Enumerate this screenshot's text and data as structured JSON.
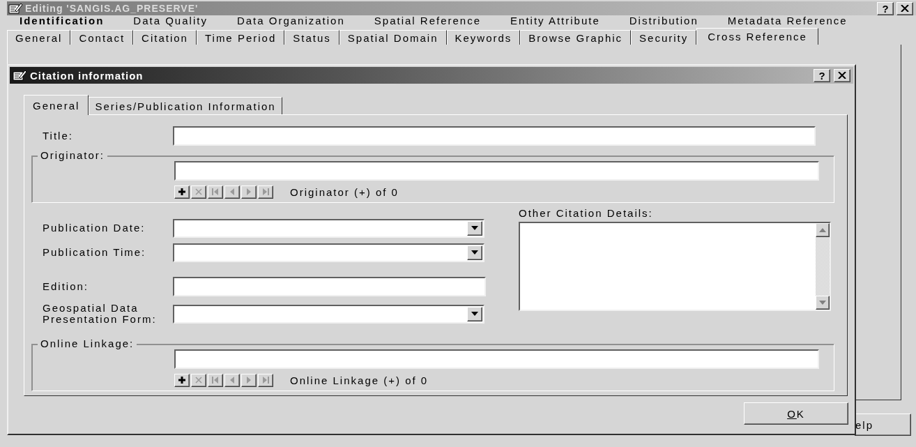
{
  "window": {
    "title": "Editing 'SANGIS.AG_PRESERVE'",
    "help": "?"
  },
  "sections": [
    {
      "label": "Identification",
      "selected": true
    },
    {
      "label": "Data Quality",
      "selected": false
    },
    {
      "label": "Data Organization",
      "selected": false
    },
    {
      "label": "Spatial Reference",
      "selected": false
    },
    {
      "label": "Entity Attribute",
      "selected": false
    },
    {
      "label": "Distribution",
      "selected": false
    },
    {
      "label": "Metadata Reference",
      "selected": false
    }
  ],
  "tabs": [
    {
      "label": "General",
      "selected": false
    },
    {
      "label": "Contact",
      "selected": false
    },
    {
      "label": "Citation",
      "selected": false
    },
    {
      "label": "Time Period",
      "selected": false
    },
    {
      "label": "Status",
      "selected": false
    },
    {
      "label": "Spatial Domain",
      "selected": false
    },
    {
      "label": "Keywords",
      "selected": false
    },
    {
      "label": "Browse Graphic",
      "selected": false
    },
    {
      "label": "Security",
      "selected": false
    },
    {
      "label": "Cross Reference",
      "selected": true
    }
  ],
  "dialog": {
    "title": "Citation information",
    "help": "?",
    "tabs": [
      {
        "label": "General",
        "selected": true
      },
      {
        "label": "Series/Publication Information",
        "selected": false
      }
    ],
    "title_field": {
      "label": "Title:"
    },
    "originator": {
      "label": "Originator:",
      "record": "Originator (+) of 0",
      "nav": [
        {
          "kind": "add",
          "disabled": false
        },
        {
          "kind": "delete",
          "disabled": true
        },
        {
          "kind": "first",
          "disabled": true
        },
        {
          "kind": "previous",
          "disabled": true
        },
        {
          "kind": "next",
          "disabled": true
        },
        {
          "kind": "last",
          "disabled": true
        }
      ]
    },
    "left_fields": [
      {
        "label": "Publication Date:",
        "kind": "dropdown"
      },
      {
        "label": "Publication Time:",
        "kind": "dropdown"
      },
      {
        "label": "Edition:",
        "kind": "text"
      },
      {
        "label": "Geospatial Data\nPresentation Form:",
        "kind": "dropdown"
      }
    ],
    "details": {
      "label": "Other Citation Details:"
    },
    "online_linkage": {
      "label": "Online Linkage:",
      "record": "Online Linkage (+) of 0",
      "nav": [
        {
          "kind": "add",
          "disabled": false
        },
        {
          "kind": "delete",
          "disabled": true
        },
        {
          "kind": "first",
          "disabled": true
        },
        {
          "kind": "previous",
          "disabled": true
        },
        {
          "kind": "next",
          "disabled": true
        },
        {
          "kind": "last",
          "disabled": true
        }
      ]
    },
    "ok_button": {
      "label": "OK",
      "mnemonic_underlined": true
    }
  },
  "help_button": {
    "label": "elp"
  }
}
